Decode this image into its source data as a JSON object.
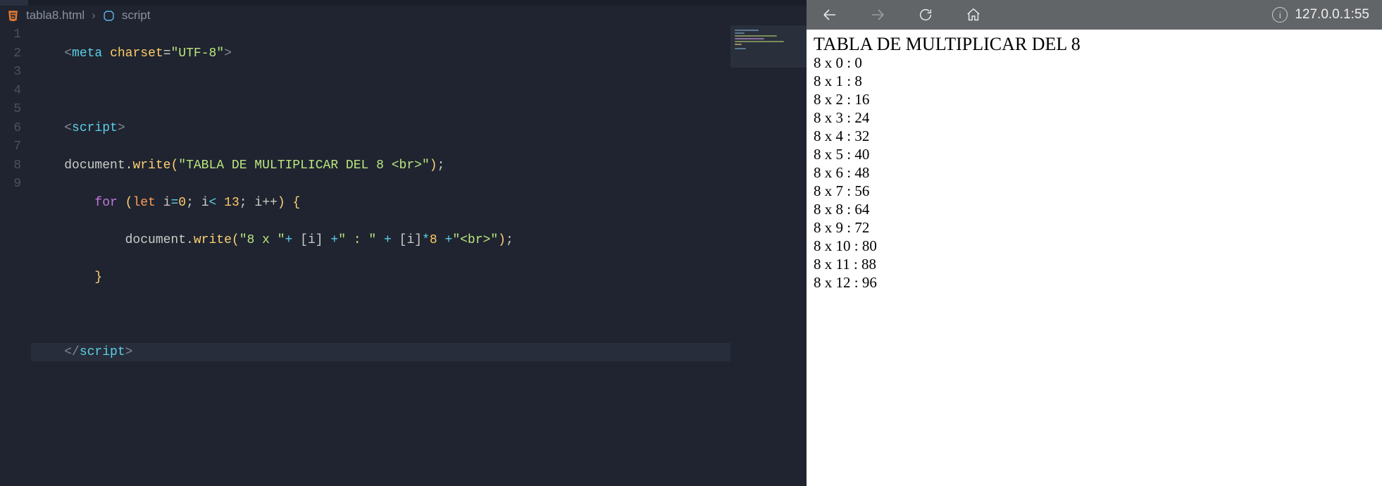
{
  "breadcrumb": {
    "file": "tabla8.html",
    "symbol": "script"
  },
  "gutter": [
    "1",
    "2",
    "3",
    "4",
    "5",
    "6",
    "7",
    "8",
    "9"
  ],
  "code": {
    "l1": {
      "tag": "meta",
      "attr": "charset",
      "val": "\"UTF-8\""
    },
    "l3": {
      "tag": "script"
    },
    "l4": {
      "obj": "document",
      "method": "write",
      "str1": "\"TABLA DE MULTIPLICAR DEL 8 <br>\""
    },
    "l5": {
      "kw": "for",
      "let": "let",
      "ivar": "i",
      "eq": "=",
      "zero": "0",
      "lt": "<",
      "limit": "13",
      "inc": "i++"
    },
    "l6": {
      "obj": "document",
      "method": "write",
      "s1": "\"8 x \"",
      "plus": "+",
      "br1": "[",
      "ivar": "i",
      "br2": "]",
      "s2": "\" : \"",
      "mul": "*",
      "eight": "8",
      "s3": "\"<br>\""
    },
    "l9": {
      "tag": "script"
    }
  },
  "browser": {
    "address": "127.0.0.1:55",
    "output_title": "TABLA DE MULTIPLICAR DEL 8",
    "rows": [
      "8 x 0 : 0",
      "8 x 1 : 8",
      "8 x 2 : 16",
      "8 x 3 : 24",
      "8 x 4 : 32",
      "8 x 5 : 40",
      "8 x 6 : 48",
      "8 x 7 : 56",
      "8 x 8 : 64",
      "8 x 9 : 72",
      "8 x 10 : 80",
      "8 x 11 : 88",
      "8 x 12 : 96"
    ]
  }
}
